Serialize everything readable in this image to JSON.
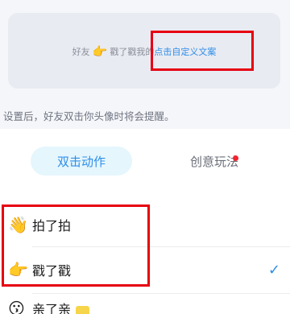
{
  "preview": {
    "friend_text": "好友",
    "action_text": "戳了戳我的",
    "custom_link": "点击自定义文案"
  },
  "hint_text": "设置后，好友双击你头像时将会提醒。",
  "tabs": [
    {
      "label": "双击动作",
      "active": true
    },
    {
      "label": "创意玩法",
      "has_dot": true
    }
  ],
  "actions": [
    {
      "icon": "wave-hand-icon",
      "label": "拍了拍",
      "selected": false
    },
    {
      "icon": "poke-finger-icon",
      "label": "戳了戳",
      "selected": true
    },
    {
      "icon": "face-icon",
      "label": "亲了亲",
      "selected": false
    }
  ],
  "colors": {
    "accent": "#2f8ee8",
    "highlight_box": "#e60012",
    "dot": "#f5222d"
  }
}
